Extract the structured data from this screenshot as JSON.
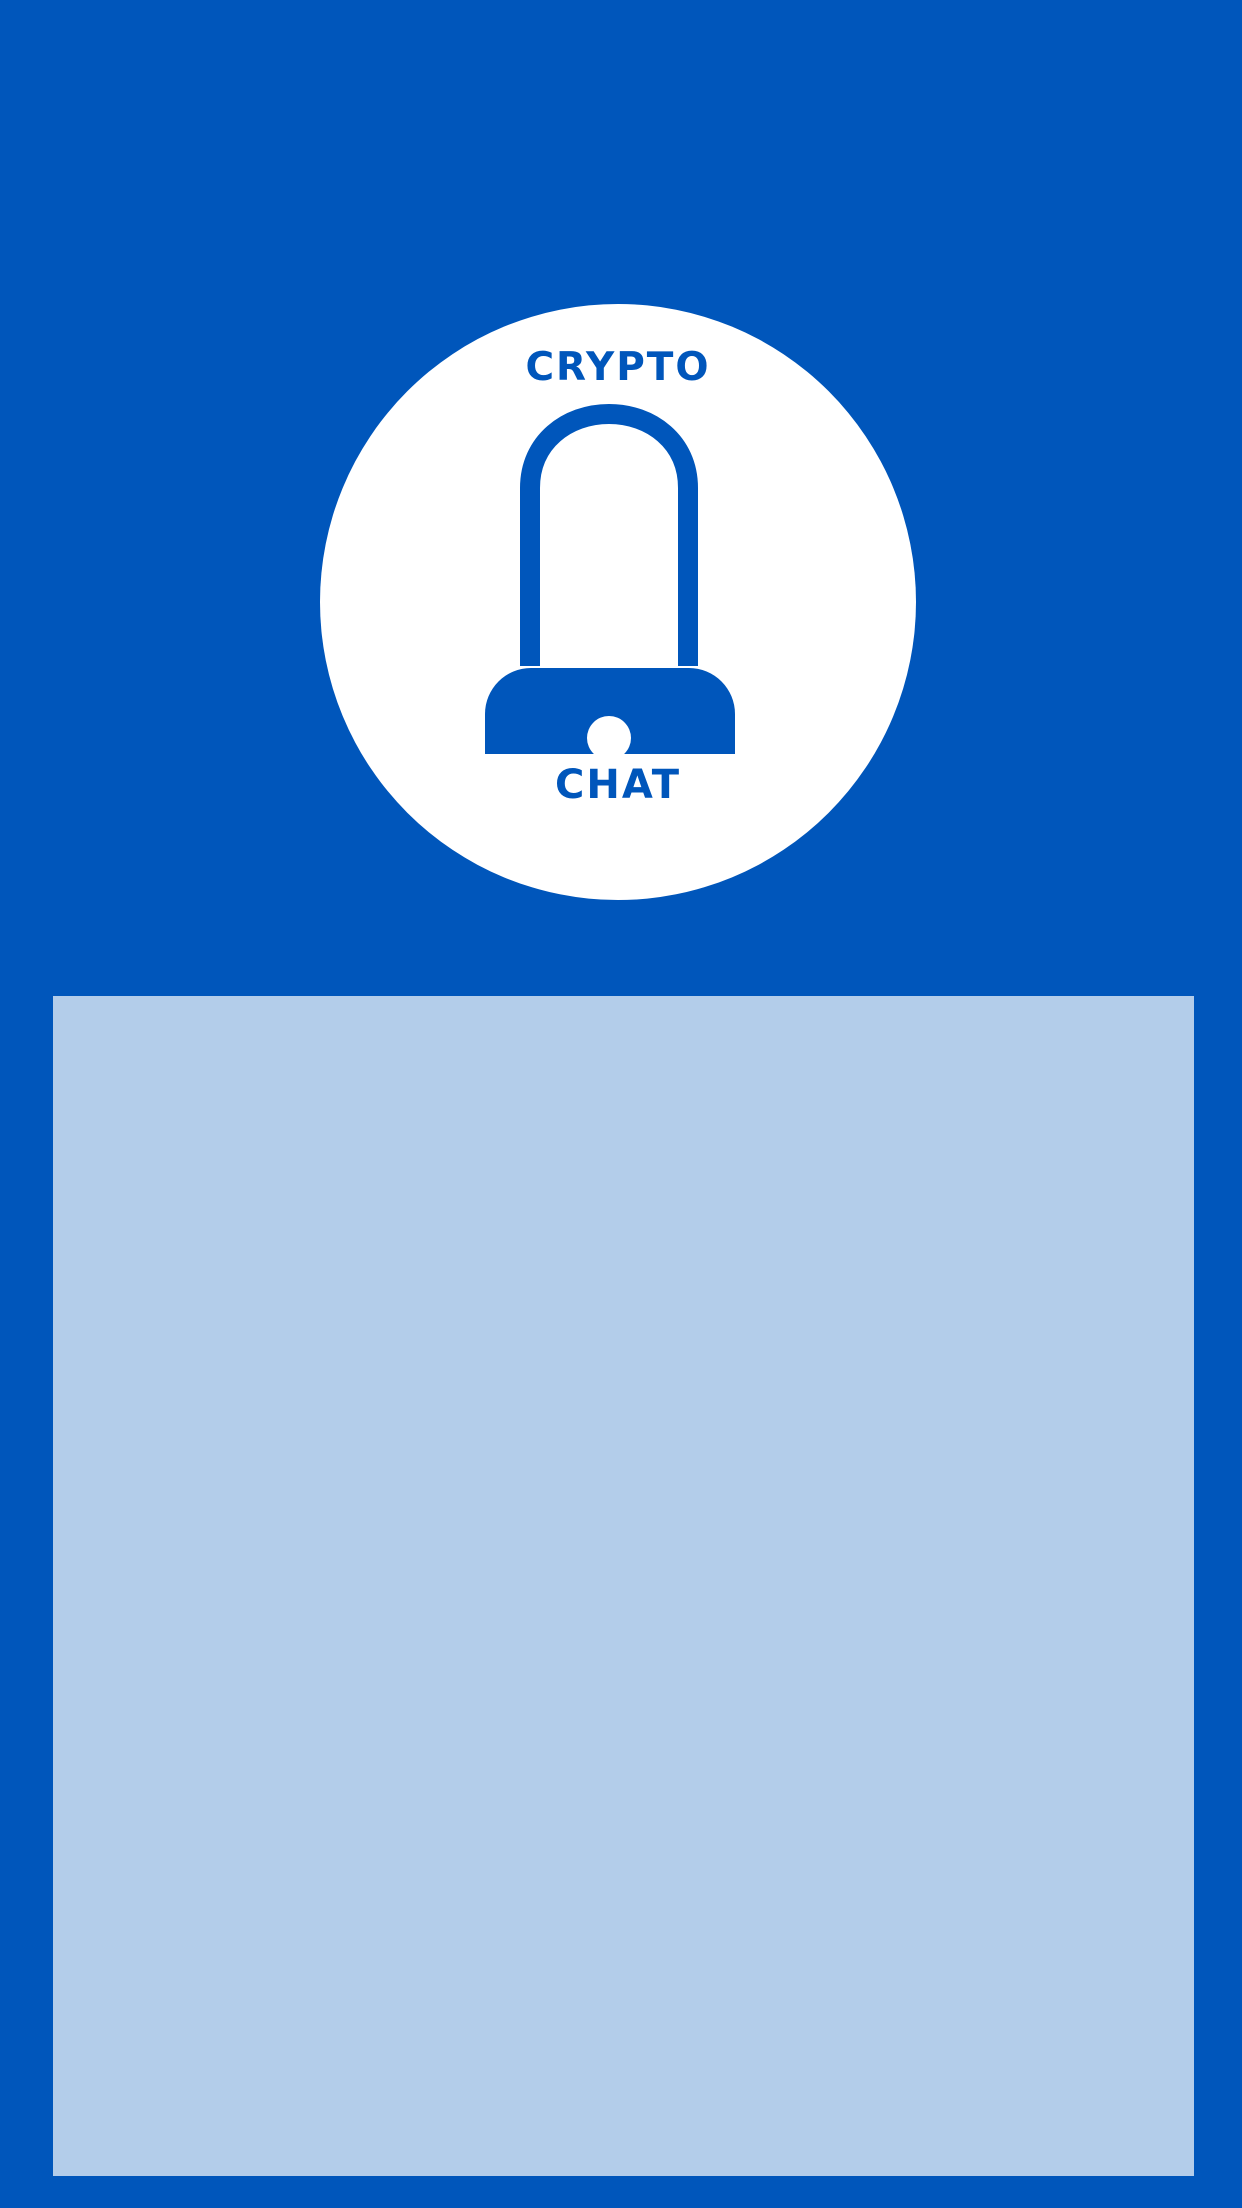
{
  "logo": {
    "top_word": "CRYPTO",
    "bottom_word": "CHAT",
    "icon": "padlock-icon"
  },
  "colors": {
    "background": "#0056bb",
    "logo_circle": "#ffffff",
    "panel": "#b3cdea"
  }
}
